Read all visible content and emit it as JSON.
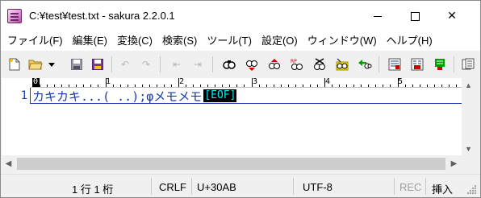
{
  "window": {
    "title": "C:¥test¥test.txt - sakura 2.2.0.1",
    "minimize_glyph": "",
    "maximize_glyph": "",
    "close_glyph": "✕"
  },
  "menu": {
    "items": [
      {
        "label": "ファイル(F)"
      },
      {
        "label": "編集(E)"
      },
      {
        "label": "変換(C)"
      },
      {
        "label": "検索(S)"
      },
      {
        "label": "ツール(T)"
      },
      {
        "label": "設定(O)"
      },
      {
        "label": "ウィンドウ(W)"
      },
      {
        "label": "ヘルプ(H)"
      }
    ]
  },
  "toolbar": {
    "icons": [
      "new-file-icon",
      "open-folder-icon",
      "dropdown-arrow-icon",
      "save-icon",
      "save-as-icon",
      "undo-icon",
      "redo-icon",
      "jump-back-icon",
      "jump-forward-icon",
      "search-icon",
      "search-next-icon",
      "search-prev-icon",
      "replace-icon",
      "clear-mark-icon",
      "bookmark-icon",
      "grep-icon",
      "outline-icon",
      "compare-icon",
      "tag-jump-icon",
      "settings-icon"
    ]
  },
  "ruler": {
    "cursor_label": "0",
    "labels": [
      "1",
      "2",
      "3",
      "4",
      "5"
    ]
  },
  "editor": {
    "line_number": "1",
    "text": "カキカキ...( ..);φメモメモ",
    "eof_marker": "[EOF]"
  },
  "statusbar": {
    "position": "1 行  1 桁",
    "line_ending": "CRLF",
    "char_code": "U+30AB",
    "encoding": "UTF-8",
    "rec": "REC",
    "insert_mode": "挿入"
  },
  "colors": {
    "text_blue": "#1a3caa",
    "eof_cyan": "#00f0f0"
  }
}
